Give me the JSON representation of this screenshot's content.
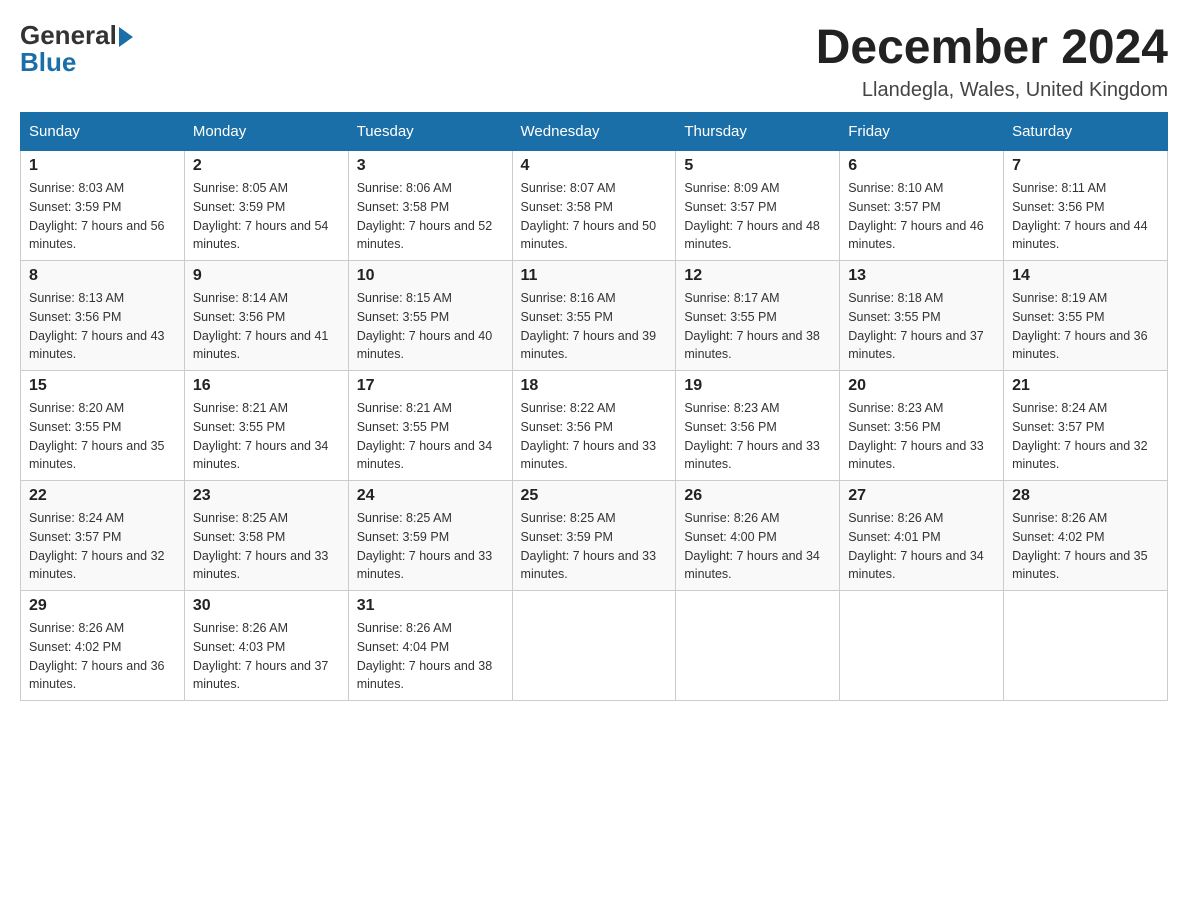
{
  "header": {
    "logo_general": "General",
    "logo_blue": "Blue",
    "month_title": "December 2024",
    "location": "Llandegla, Wales, United Kingdom"
  },
  "days_of_week": [
    "Sunday",
    "Monday",
    "Tuesday",
    "Wednesday",
    "Thursday",
    "Friday",
    "Saturday"
  ],
  "weeks": [
    [
      {
        "day": "1",
        "sunrise": "8:03 AM",
        "sunset": "3:59 PM",
        "daylight": "7 hours and 56 minutes."
      },
      {
        "day": "2",
        "sunrise": "8:05 AM",
        "sunset": "3:59 PM",
        "daylight": "7 hours and 54 minutes."
      },
      {
        "day": "3",
        "sunrise": "8:06 AM",
        "sunset": "3:58 PM",
        "daylight": "7 hours and 52 minutes."
      },
      {
        "day": "4",
        "sunrise": "8:07 AM",
        "sunset": "3:58 PM",
        "daylight": "7 hours and 50 minutes."
      },
      {
        "day": "5",
        "sunrise": "8:09 AM",
        "sunset": "3:57 PM",
        "daylight": "7 hours and 48 minutes."
      },
      {
        "day": "6",
        "sunrise": "8:10 AM",
        "sunset": "3:57 PM",
        "daylight": "7 hours and 46 minutes."
      },
      {
        "day": "7",
        "sunrise": "8:11 AM",
        "sunset": "3:56 PM",
        "daylight": "7 hours and 44 minutes."
      }
    ],
    [
      {
        "day": "8",
        "sunrise": "8:13 AM",
        "sunset": "3:56 PM",
        "daylight": "7 hours and 43 minutes."
      },
      {
        "day": "9",
        "sunrise": "8:14 AM",
        "sunset": "3:56 PM",
        "daylight": "7 hours and 41 minutes."
      },
      {
        "day": "10",
        "sunrise": "8:15 AM",
        "sunset": "3:55 PM",
        "daylight": "7 hours and 40 minutes."
      },
      {
        "day": "11",
        "sunrise": "8:16 AM",
        "sunset": "3:55 PM",
        "daylight": "7 hours and 39 minutes."
      },
      {
        "day": "12",
        "sunrise": "8:17 AM",
        "sunset": "3:55 PM",
        "daylight": "7 hours and 38 minutes."
      },
      {
        "day": "13",
        "sunrise": "8:18 AM",
        "sunset": "3:55 PM",
        "daylight": "7 hours and 37 minutes."
      },
      {
        "day": "14",
        "sunrise": "8:19 AM",
        "sunset": "3:55 PM",
        "daylight": "7 hours and 36 minutes."
      }
    ],
    [
      {
        "day": "15",
        "sunrise": "8:20 AM",
        "sunset": "3:55 PM",
        "daylight": "7 hours and 35 minutes."
      },
      {
        "day": "16",
        "sunrise": "8:21 AM",
        "sunset": "3:55 PM",
        "daylight": "7 hours and 34 minutes."
      },
      {
        "day": "17",
        "sunrise": "8:21 AM",
        "sunset": "3:55 PM",
        "daylight": "7 hours and 34 minutes."
      },
      {
        "day": "18",
        "sunrise": "8:22 AM",
        "sunset": "3:56 PM",
        "daylight": "7 hours and 33 minutes."
      },
      {
        "day": "19",
        "sunrise": "8:23 AM",
        "sunset": "3:56 PM",
        "daylight": "7 hours and 33 minutes."
      },
      {
        "day": "20",
        "sunrise": "8:23 AM",
        "sunset": "3:56 PM",
        "daylight": "7 hours and 33 minutes."
      },
      {
        "day": "21",
        "sunrise": "8:24 AM",
        "sunset": "3:57 PM",
        "daylight": "7 hours and 32 minutes."
      }
    ],
    [
      {
        "day": "22",
        "sunrise": "8:24 AM",
        "sunset": "3:57 PM",
        "daylight": "7 hours and 32 minutes."
      },
      {
        "day": "23",
        "sunrise": "8:25 AM",
        "sunset": "3:58 PM",
        "daylight": "7 hours and 33 minutes."
      },
      {
        "day": "24",
        "sunrise": "8:25 AM",
        "sunset": "3:59 PM",
        "daylight": "7 hours and 33 minutes."
      },
      {
        "day": "25",
        "sunrise": "8:25 AM",
        "sunset": "3:59 PM",
        "daylight": "7 hours and 33 minutes."
      },
      {
        "day": "26",
        "sunrise": "8:26 AM",
        "sunset": "4:00 PM",
        "daylight": "7 hours and 34 minutes."
      },
      {
        "day": "27",
        "sunrise": "8:26 AM",
        "sunset": "4:01 PM",
        "daylight": "7 hours and 34 minutes."
      },
      {
        "day": "28",
        "sunrise": "8:26 AM",
        "sunset": "4:02 PM",
        "daylight": "7 hours and 35 minutes."
      }
    ],
    [
      {
        "day": "29",
        "sunrise": "8:26 AM",
        "sunset": "4:02 PM",
        "daylight": "7 hours and 36 minutes."
      },
      {
        "day": "30",
        "sunrise": "8:26 AM",
        "sunset": "4:03 PM",
        "daylight": "7 hours and 37 minutes."
      },
      {
        "day": "31",
        "sunrise": "8:26 AM",
        "sunset": "4:04 PM",
        "daylight": "7 hours and 38 minutes."
      },
      null,
      null,
      null,
      null
    ]
  ]
}
